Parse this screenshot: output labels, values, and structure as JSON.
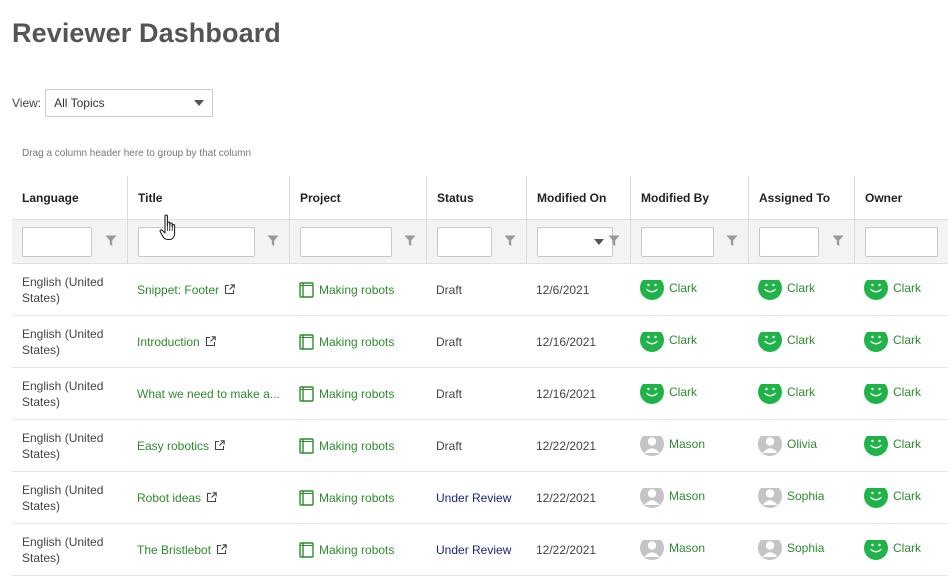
{
  "page": {
    "title": "Reviewer Dashboard"
  },
  "view": {
    "label": "View:",
    "selected": "All Topics"
  },
  "grid": {
    "group_hint": "Drag a column header here to group by that column",
    "columns": [
      "Language",
      "Title",
      "Project",
      "Status",
      "Modified On",
      "Modified By",
      "Assigned To",
      "Owner"
    ],
    "rows": [
      {
        "language": "English (United States)",
        "title": "Snippet: Footer",
        "project": "Making robots",
        "status": "Draft",
        "modified_on": "12/6/2021",
        "modified_by": "Clark",
        "assigned_to": "Clark",
        "owner": "Clark"
      },
      {
        "language": "English (United States)",
        "title": "Introduction",
        "project": "Making robots",
        "status": "Draft",
        "modified_on": "12/16/2021",
        "modified_by": "Clark",
        "assigned_to": "Clark",
        "owner": "Clark"
      },
      {
        "language": "English (United States)",
        "title": "What we need to make a...",
        "project": "Making robots",
        "status": "Draft",
        "modified_on": "12/16/2021",
        "modified_by": "Clark",
        "assigned_to": "Clark",
        "owner": "Clark"
      },
      {
        "language": "English (United States)",
        "title": "Easy robotics",
        "project": "Making robots",
        "status": "Draft",
        "modified_on": "12/22/2021",
        "modified_by": "Mason",
        "assigned_to": "Olivia",
        "owner": "Clark"
      },
      {
        "language": "English (United States)",
        "title": "Robot ideas",
        "project": "Making robots",
        "status": "Under Review",
        "modified_on": "12/22/2021",
        "modified_by": "Mason",
        "assigned_to": "Sophia",
        "owner": "Clark"
      },
      {
        "language": "English (United States)",
        "title": "The Bristlebot",
        "project": "Making robots",
        "status": "Under Review",
        "modified_on": "12/22/2021",
        "modified_by": "Mason",
        "assigned_to": "Sophia",
        "owner": "Clark"
      }
    ]
  },
  "colors": {
    "link": "#2e8b2e",
    "avatar_active": "#1fb34a",
    "avatar_inactive": "#c4c4c4",
    "status_review": "#1a237e"
  },
  "icons": {
    "external_link": "external-link-icon",
    "project": "book-icon",
    "filter": "funnel-icon",
    "dropdown": "chevron-down-icon",
    "cursor": "hand-pointer-icon"
  }
}
